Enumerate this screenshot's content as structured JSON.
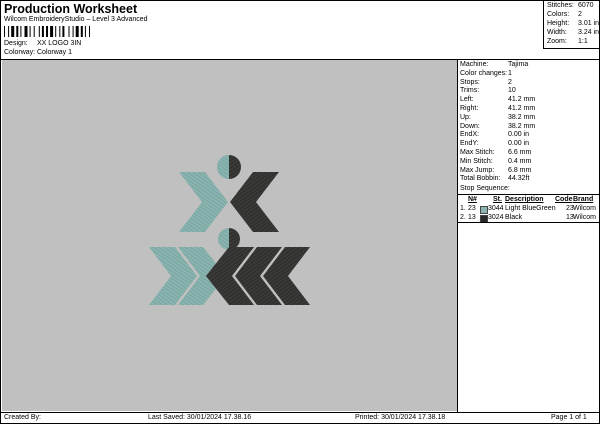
{
  "header": {
    "title": "Production Worksheet",
    "subtitle": "Wilcom EmbroideryStudio – Level 3 Advanced",
    "design_label": "Design:",
    "design_value": "XX LOGO 3IN",
    "colorway_label": "Colorway:",
    "colorway_value": "Colorway 1"
  },
  "summary": {
    "stitches_label": "Stitches:",
    "stitches_value": "6070",
    "colors_label": "Colors:",
    "colors_value": "2",
    "height_label": "Height:",
    "height_value": "3.01 in",
    "width_label": "Width:",
    "width_value": "3.24 in",
    "zoom_label": "Zoom:",
    "zoom_value": "1:1"
  },
  "properties": [
    {
      "label": "Machine:",
      "value": "Tajima"
    },
    {
      "label": "Color changes:",
      "value": "1"
    },
    {
      "label": "Stops:",
      "value": "2"
    },
    {
      "label": "Trims:",
      "value": "10"
    },
    {
      "label": "Left:",
      "value": "41.2 mm"
    },
    {
      "label": "Right:",
      "value": "41.2 mm"
    },
    {
      "label": "Up:",
      "value": "38.2 mm"
    },
    {
      "label": "Down:",
      "value": "38.2 mm"
    },
    {
      "label": "EndX:",
      "value": "0.00 in"
    },
    {
      "label": "EndY:",
      "value": "0.00 in"
    },
    {
      "label": "Max Stitch:",
      "value": "6.6 mm"
    },
    {
      "label": "Min Stitch:",
      "value": "0.4 mm"
    },
    {
      "label": "Max Jump:",
      "value": "6.8 mm"
    },
    {
      "label": "Total Bobbin:",
      "value": "44.32ft"
    }
  ],
  "sequence": {
    "title": "Stop Sequence:",
    "headers": {
      "n": "N#",
      "st": "St.",
      "description": "Description",
      "code": "Code",
      "brand": "Brand"
    },
    "rows": [
      {
        "index": "1.",
        "n": "23",
        "st": "3044",
        "description": "Light BlueGreen",
        "code": "23",
        "brand": "Wilcom",
        "color": "#8ab4b0"
      },
      {
        "index": "2.",
        "n": "13",
        "st": "3024",
        "description": "Black",
        "code": "13",
        "brand": "Wilcom",
        "color": "#2a2a2a"
      }
    ]
  },
  "footer": {
    "created_by": "Created By:",
    "last_saved": "Last Saved: 30/01/2024 17.38.16",
    "printed": "Printed: 30/01/2024 17.38.18",
    "page": "Page 1 of 1"
  },
  "colors": {
    "canvas": "#c0c0c0",
    "thread_1": "#8ab4b0",
    "thread_2": "#3a3a38"
  }
}
